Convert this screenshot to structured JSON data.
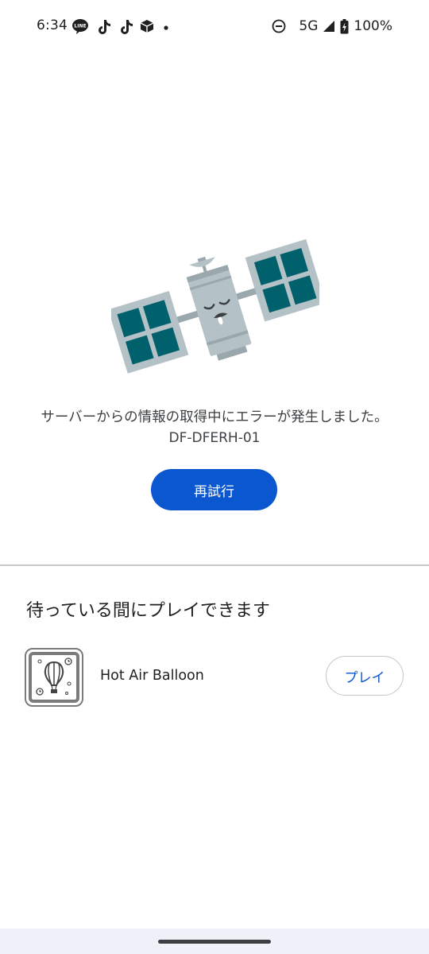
{
  "status_bar": {
    "time": "6:34",
    "notification_icons": [
      "line-icon",
      "tiktok-icon",
      "tiktok-icon",
      "cube-app-icon",
      "dot-icon"
    ],
    "network": "5G",
    "battery": "100%",
    "status_icons": [
      "dnd-icon",
      "signal-icon",
      "battery-charging-icon"
    ]
  },
  "error": {
    "illustration": "sleeping-satellite-illustration",
    "message": "サーバーからの情報の取得中にエラーが発生しました。",
    "code": "DF-DFERH-01",
    "retry_label": "再試行"
  },
  "games": {
    "title": "待っている間にプレイできます",
    "items": [
      {
        "name": "Hot Air Balloon",
        "icon": "hot-air-balloon-game-icon",
        "play_label": "プレイ"
      }
    ]
  },
  "colors": {
    "accent": "#0b57d0",
    "panel": "#00606b",
    "satellite_body": "#b4c1c6"
  }
}
